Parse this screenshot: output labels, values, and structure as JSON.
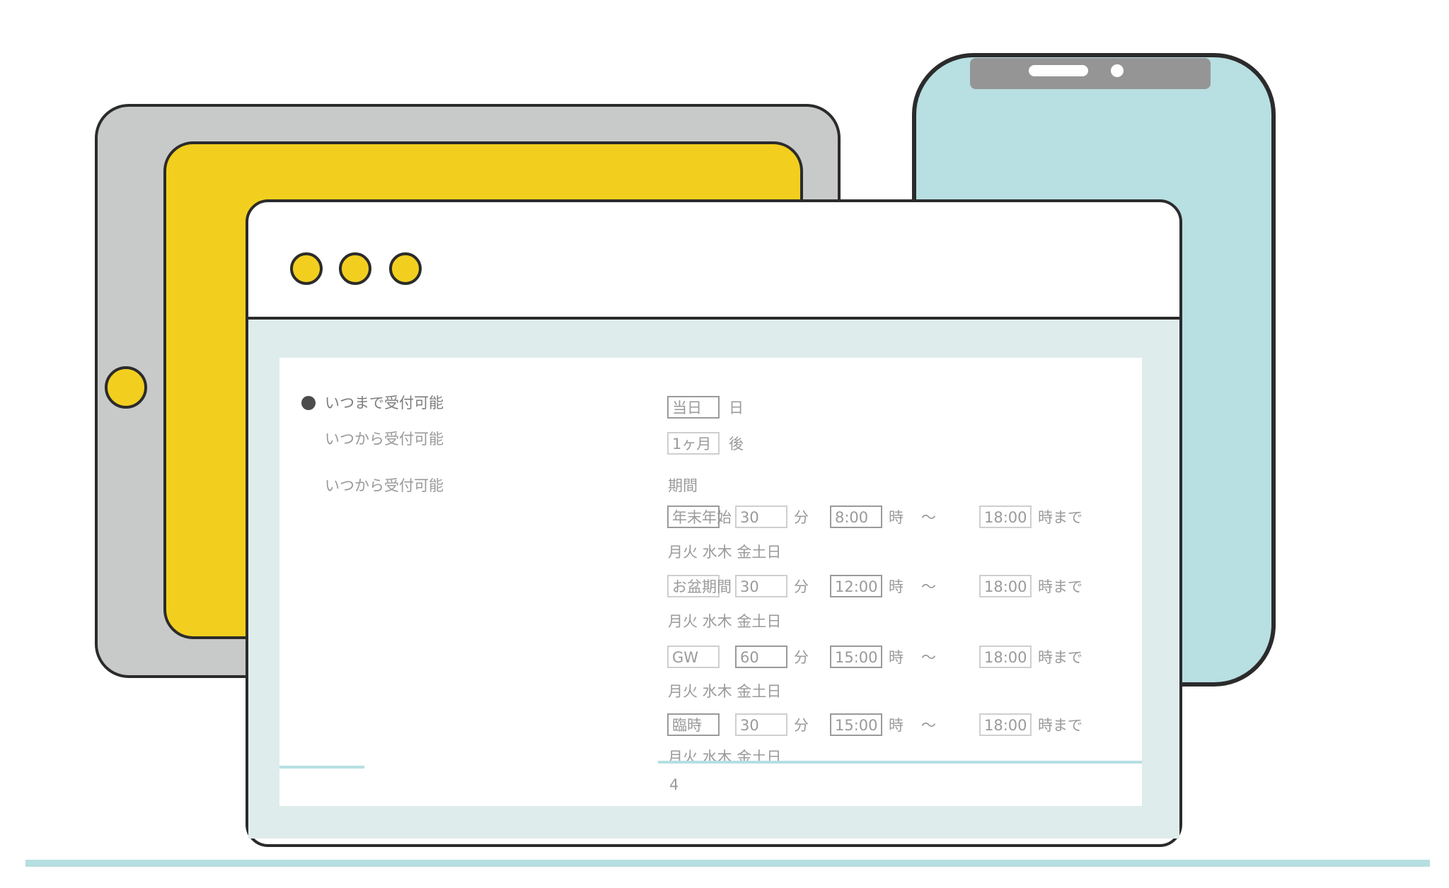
{
  "colors": {
    "tablet_body": "#c8c9c9",
    "tablet_screen": "#f2cf1f",
    "phone_body": "#b8dfe2",
    "phone_notch": "#959595",
    "window_body": "#ffffff",
    "window_content_bg": "#dfecec",
    "window_dot": "#f2cf1f",
    "outline": "#2b2b2b",
    "floor_line": "#b6dfe2"
  },
  "icons": {
    "window_dots": [
      "window-dot-icon",
      "window-dot-icon",
      "window-dot-icon"
    ],
    "tablet_home": "home-button-icon",
    "phone_speaker": "speaker-icon",
    "phone_camera": "camera-icon"
  },
  "form": {
    "settings": [
      {
        "label": "いつまで受付可能",
        "value": "当日",
        "unit": "日"
      },
      {
        "label": "いつから受付可能",
        "value": "1ヶ月",
        "unit": "後"
      },
      {
        "label": "いつから受付可能",
        "value": "",
        "unit": ""
      }
    ],
    "schedule_header": "期間",
    "schedule_rows": [
      {
        "name": "年末年始",
        "count": "30",
        "count_unit": "分",
        "start": "8:00",
        "start_unit": "時",
        "end": "18:00",
        "end_unit": "時まで",
        "weekday_flags": "月火 水木 金土日"
      },
      {
        "name": "お盆期間",
        "count": "30",
        "count_unit": "分",
        "start": "12:00",
        "start_unit": "時",
        "end": "18:00",
        "end_unit": "時まで",
        "weekday_flags": "月火 水木 金土日"
      },
      {
        "name": "GW",
        "count": "60",
        "count_unit": "分",
        "start": "15:00",
        "start_unit": "時",
        "end": "18:00",
        "end_unit": "時まで",
        "weekday_flags": "月火 水木 金土日"
      },
      {
        "name": "臨時",
        "count": "30",
        "count_unit": "分",
        "start": "15:00",
        "start_unit": "時",
        "end": "18:00",
        "end_unit": "時まで",
        "weekday_flags": "月火 水木 金土日"
      }
    ],
    "footer_value": "4"
  }
}
